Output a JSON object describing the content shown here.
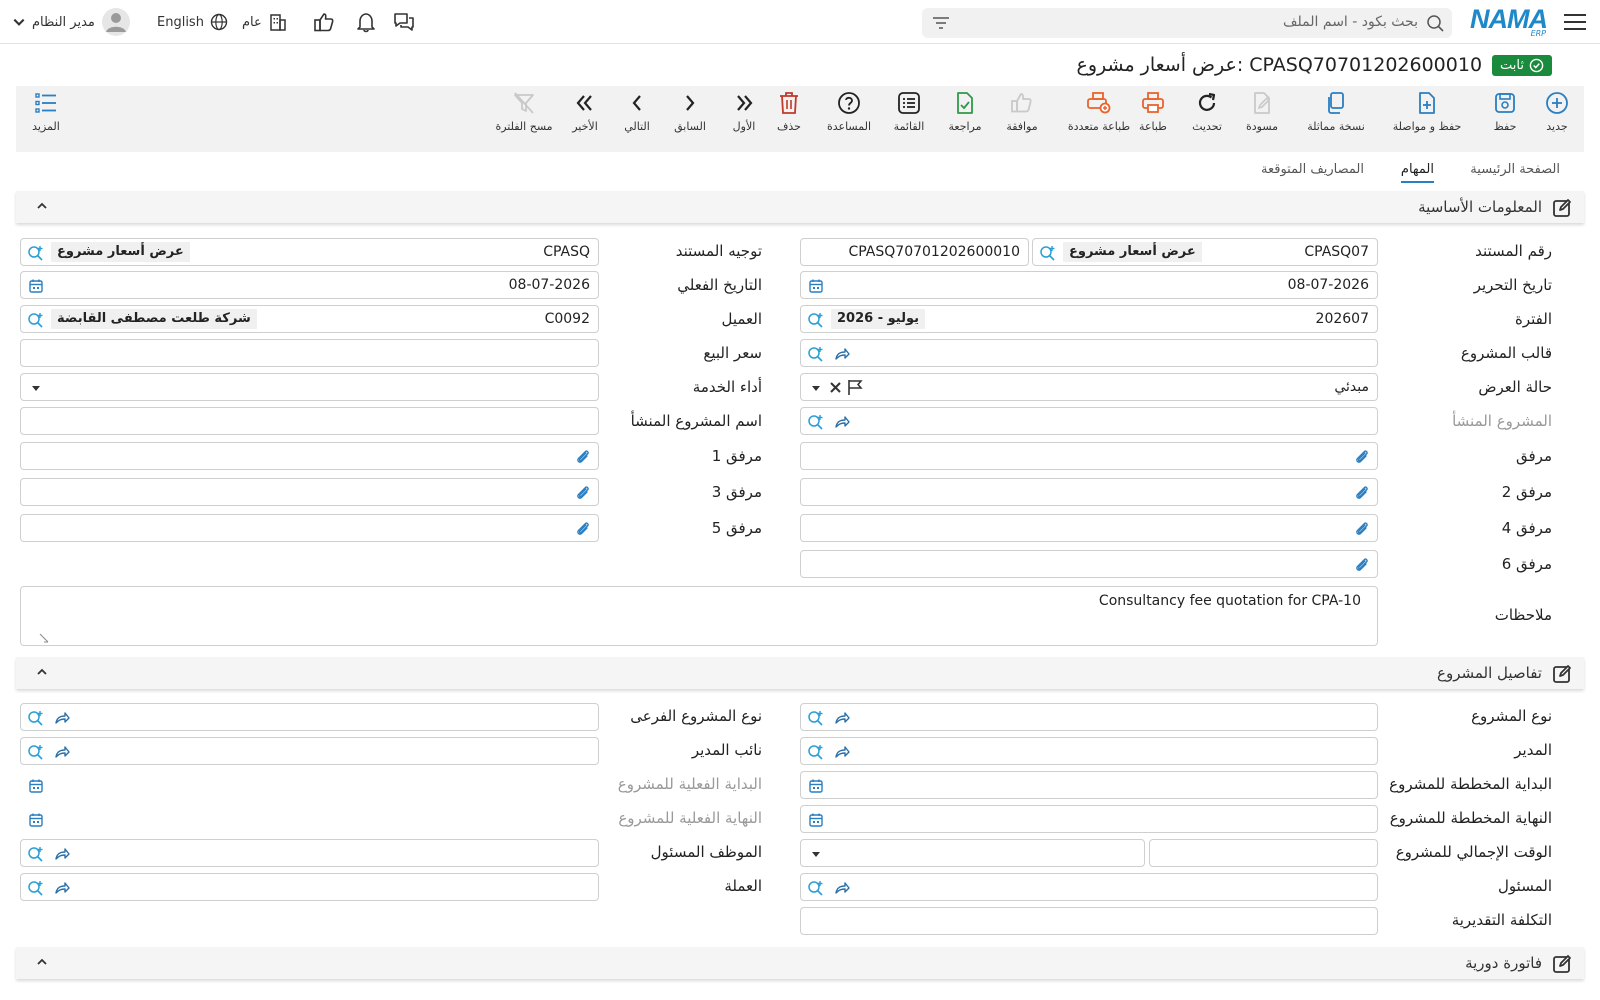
{
  "app": {
    "logo_big": "NAMA",
    "logo_small": "ERP"
  },
  "topbar": {
    "search_placeholder": "بحث بكود - اسم الملف",
    "user": "مدير النظام",
    "language": "English",
    "branch": "عام"
  },
  "title": {
    "text": "عرض أسعار مشروع: CPASQ70701202600010",
    "status": "ثابت"
  },
  "toolbar": {
    "new": "جديد",
    "save": "حفظ",
    "save_continue": "حفظ و مواصلة",
    "duplicate": "نسخة مماثلة",
    "draft": "مسودة",
    "refresh": "تحديث",
    "print": "طباعة",
    "multi_print": "طباعة متعددة",
    "approve": "موافقة",
    "review": "مراجعة",
    "list": "القائمة",
    "help": "المساعدة",
    "delete": "حذف",
    "first": "الأول",
    "previous": "السابق",
    "next": "التالي",
    "last": "الأخير",
    "clear_filter": "مسح الفلترة",
    "more": "المزيد"
  },
  "tabs": [
    "الصفحة الرئيسية",
    "المهام",
    "المصاريف المتوقعة"
  ],
  "sections": {
    "basic": "المعلومات الأساسية",
    "project": "تفاصيل المشروع",
    "recurring": "فاتورة دورية"
  },
  "basic": {
    "doc_number_label": "رقم المستند",
    "doc_number_code": "CPASQ07",
    "doc_number_type": "عرض أسعار مشروع",
    "doc_number_full": "CPASQ70701202600010",
    "doc_direction_label": "توجيه المستند",
    "doc_direction_code": "CPASQ",
    "doc_direction_name": "عرض أسعار مشروع",
    "edit_date_label": "تاريخ التحرير",
    "edit_date": "08-07-2026",
    "actual_date_label": "التاريخ الفعلي",
    "actual_date": "08-07-2026",
    "period_label": "الفترة",
    "period_code": "202607",
    "period_name": "2026 - يوليو",
    "customer_label": "العميل",
    "customer_code": "C0092",
    "customer_name": "شركة طلعت مصطفى القابضة",
    "template_label": "قالب المشروع",
    "sale_price_label": "سعر البيع",
    "offer_status_label": "حالة العرض",
    "offer_status": "مبدئي",
    "service_label": "أداء الخدمة",
    "origin_project_label": "المشروع المنشأ",
    "origin_project_name_label": "اسم المشروع المنشأ",
    "attach_label": "مرفق",
    "attach1_label": "مرفق 1",
    "attach2_label": "مرفق 2",
    "attach3_label": "مرفق 3",
    "attach4_label": "مرفق 4",
    "attach5_label": "مرفق 5",
    "attach6_label": "مرفق 6",
    "notes_label": "ملاحظات",
    "notes": "Consultancy fee quotation for CPA-10"
  },
  "project": {
    "type_label": "نوع المشروع",
    "subtype_label": "نوع المشروع الفرعى",
    "manager_label": "المدير",
    "deputy_label": "نائب المدير",
    "planned_start_label": "البداية المخططة للمشروع",
    "actual_start_label": "البداية الفعلية للمشروع",
    "planned_end_label": "النهاية المخططة للمشروع",
    "actual_end_label": "النهاية الفعلية للمشروع",
    "total_time_label": "الوقت الإجمالي للمشروع",
    "employee_label": "الموظف المسئول",
    "responsible_label": "المسئول",
    "currency_label": "العملة",
    "estimated_cost_label": "التكلفة التقديرية"
  },
  "colors": {
    "accent": "#2a7fc2",
    "status_green": "#1a8a3c",
    "orange": "#e8642a",
    "danger": "#c0392b"
  }
}
